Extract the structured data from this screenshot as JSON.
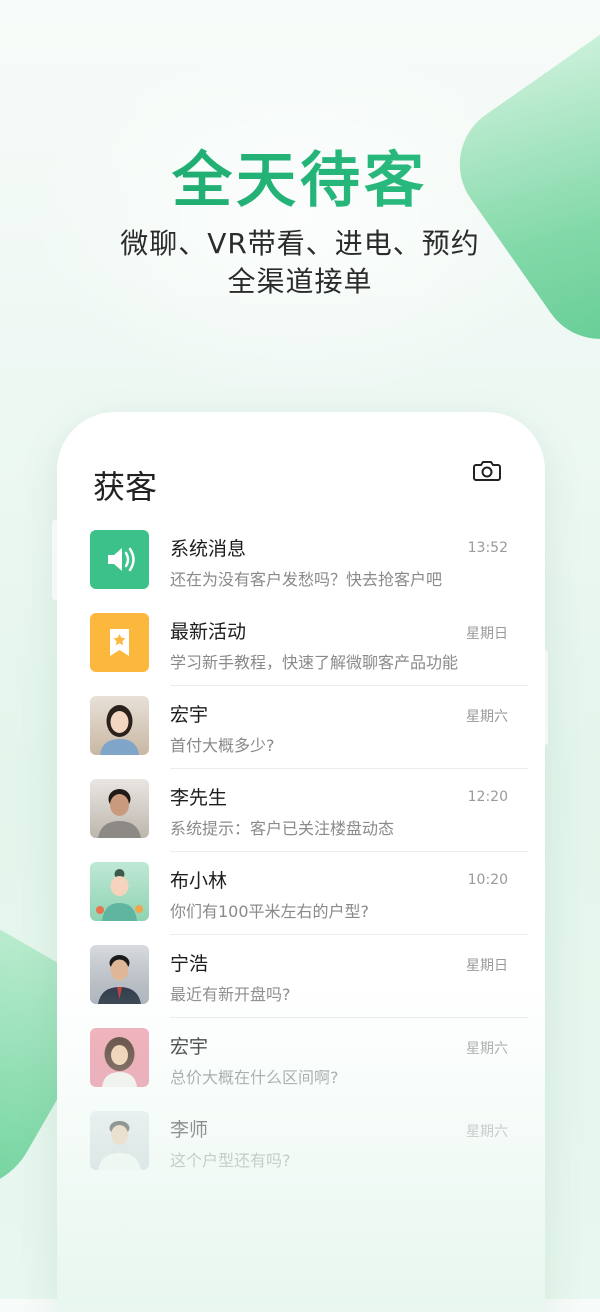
{
  "hero": {
    "title": "全天待客",
    "subtitle_line1": "微聊、VR带看、进电、预约",
    "subtitle_line2": "全渠道接单"
  },
  "app": {
    "title": "获客",
    "camera_icon": "camera-icon"
  },
  "conversations": [
    {
      "name": "系统消息",
      "message": "还在为没有客户发愁吗？快去抢客户吧",
      "time": "13:52",
      "avatar": "speaker-icon",
      "color": "#3cc18a"
    },
    {
      "name": "最新活动",
      "message": "学习新手教程，快速了解微聊客产品功能",
      "time": "星期日",
      "avatar": "star-bookmark-icon",
      "color": "#fbb83c"
    },
    {
      "name": "宏宇",
      "message": "首付大概多少?",
      "time": "星期六",
      "avatar": "avatar-woman-1",
      "color": "#c9b7a3"
    },
    {
      "name": "李先生",
      "message": "系统提示：客户已关注楼盘动态",
      "time": "12:20",
      "avatar": "avatar-man-1",
      "color": "#7a6a5c"
    },
    {
      "name": "布小林",
      "message": "你们有100平米左右的户型?",
      "time": "10:20",
      "avatar": "avatar-cartoon-girl",
      "color": "#8fd3b2"
    },
    {
      "name": "宁浩",
      "message": "最近有新开盘吗?",
      "time": "星期日",
      "avatar": "avatar-man-2",
      "color": "#5b6470"
    },
    {
      "name": "宏宇",
      "message": "总价大概在什么区间啊?",
      "time": "星期六",
      "avatar": "avatar-woman-2",
      "color": "#e8869a"
    },
    {
      "name": "李师",
      "message": "这个户型还有吗?",
      "time": "星期六",
      "avatar": "avatar-man-3",
      "color": "#aab4be"
    }
  ]
}
